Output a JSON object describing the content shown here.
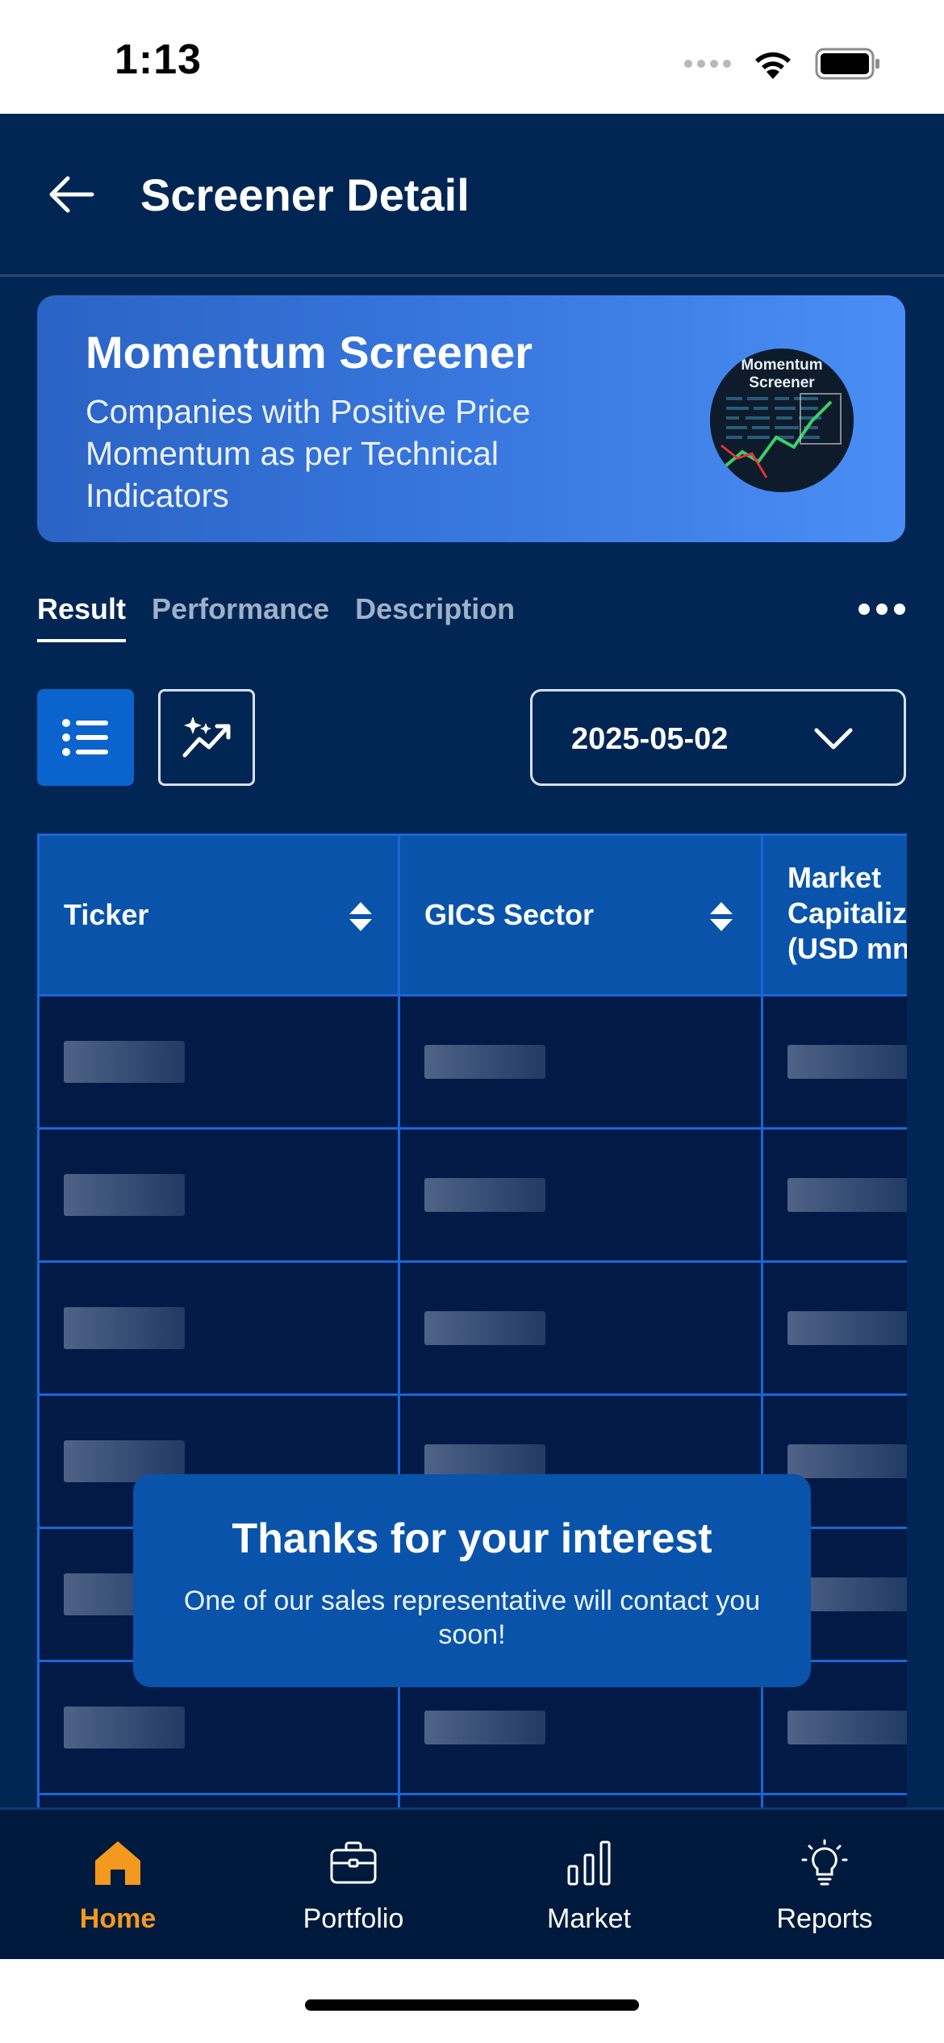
{
  "status_bar": {
    "time": "1:13"
  },
  "header": {
    "title": "Screener Detail"
  },
  "banner": {
    "title": "Momentum Screener",
    "description": "Companies with Positive Price Momentum as per Technical Indicators",
    "image_label": "Momentum Screener"
  },
  "tabs": [
    {
      "label": "Result",
      "active": true
    },
    {
      "label": "Performance",
      "active": false
    },
    {
      "label": "Description",
      "active": false
    }
  ],
  "filters": {
    "date": "2025-05-02"
  },
  "table": {
    "columns": [
      {
        "label": "Ticker"
      },
      {
        "label": "GICS Sector"
      },
      {
        "label": "Market\nCapitaliz\n(USD mn"
      }
    ],
    "row_count": 6
  },
  "toast": {
    "title": "Thanks for your interest",
    "message": "One of our sales representative will contact you soon!"
  },
  "bottom_nav": [
    {
      "label": "Home",
      "icon": "home-icon",
      "active": true
    },
    {
      "label": "Portfolio",
      "icon": "briefcase-icon",
      "active": false
    },
    {
      "label": "Market",
      "icon": "bar-chart-icon",
      "active": false
    },
    {
      "label": "Reports",
      "icon": "lightbulb-icon",
      "active": false
    }
  ],
  "colors": {
    "background": "#012654",
    "accent": "#0b63ce",
    "active_nav": "#f39a1e",
    "table_border": "#1a66d6"
  }
}
